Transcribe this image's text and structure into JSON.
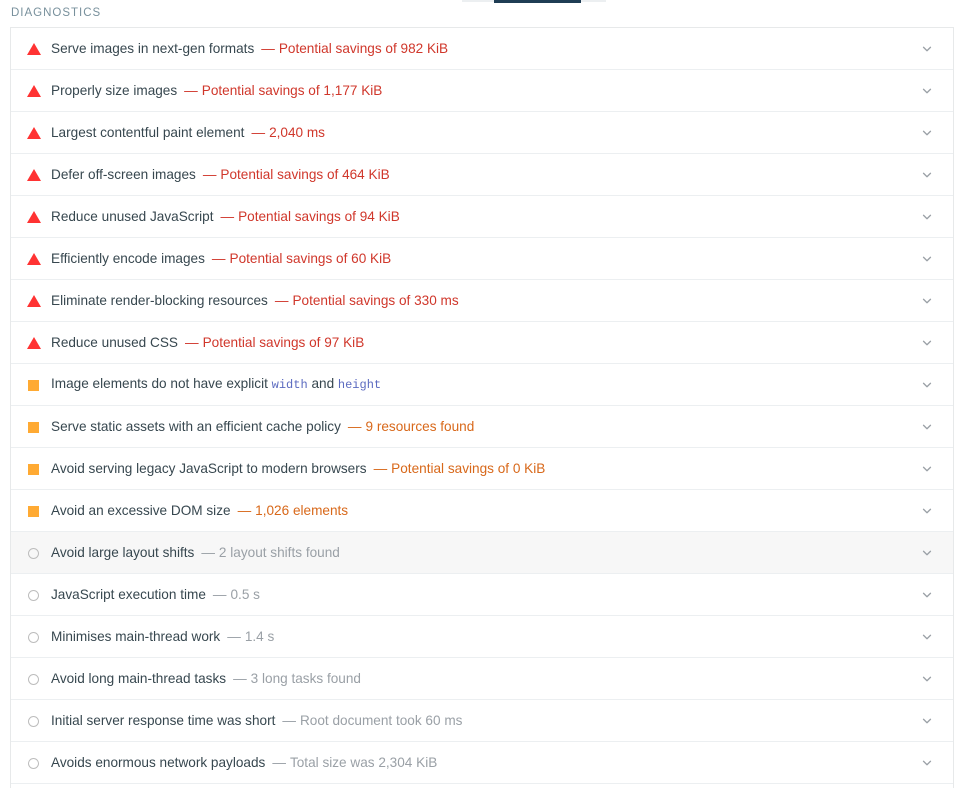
{
  "section": {
    "heading": "DIAGNOSTICS"
  },
  "colors": {
    "fail": "#d0372b",
    "average": "#d8681a",
    "pass": "#9aa0a6",
    "fail_icon": "#ff3333",
    "average_icon": "#ffaa33",
    "pass_icon": "#bdbdbd",
    "title_text": "#37474f",
    "heading_text": "#78909c",
    "tab_underline": "#1f3d54",
    "row_highlight": "#f7f7f7",
    "code_text": "#5c6bc0"
  },
  "icons": {
    "fail": "warning-triangle-icon",
    "average": "warning-square-icon",
    "pass": "circle-outline-icon",
    "expand": "chevron-down-icon"
  },
  "audits": [
    {
      "severity": "fail",
      "title": "Serve images in next-gen formats",
      "separator": "—",
      "display_value": "Potential savings of 982 KiB",
      "highlighted": false
    },
    {
      "severity": "fail",
      "title": "Properly size images",
      "separator": "—",
      "display_value": "Potential savings of 1,177 KiB",
      "highlighted": false
    },
    {
      "severity": "fail",
      "title": "Largest contentful paint element",
      "separator": "—",
      "display_value": "2,040 ms",
      "highlighted": false
    },
    {
      "severity": "fail",
      "title": "Defer off-screen images",
      "separator": "—",
      "display_value": "Potential savings of 464 KiB",
      "highlighted": false
    },
    {
      "severity": "fail",
      "title": "Reduce unused JavaScript",
      "separator": "—",
      "display_value": "Potential savings of 94 KiB",
      "highlighted": false
    },
    {
      "severity": "fail",
      "title": "Efficiently encode images",
      "separator": "—",
      "display_value": "Potential savings of 60 KiB",
      "highlighted": false
    },
    {
      "severity": "fail",
      "title": "Eliminate render-blocking resources",
      "separator": "—",
      "display_value": "Potential savings of 330 ms",
      "highlighted": false
    },
    {
      "severity": "fail",
      "title": "Reduce unused CSS",
      "separator": "—",
      "display_value": "Potential savings of 97 KiB",
      "highlighted": false
    },
    {
      "severity": "average",
      "title_parts": [
        {
          "type": "text",
          "value": "Image elements do not have explicit "
        },
        {
          "type": "code",
          "value": "width"
        },
        {
          "type": "text",
          "value": " and "
        },
        {
          "type": "code",
          "value": "height"
        }
      ],
      "title": "Image elements do not have explicit width and height",
      "separator": "",
      "display_value": "",
      "highlighted": false
    },
    {
      "severity": "average",
      "title": "Serve static assets with an efficient cache policy",
      "separator": "—",
      "display_value": "9 resources found",
      "highlighted": false
    },
    {
      "severity": "average",
      "title": "Avoid serving legacy JavaScript to modern browsers",
      "separator": "—",
      "display_value": "Potential savings of 0 KiB",
      "highlighted": false
    },
    {
      "severity": "average",
      "title": "Avoid an excessive DOM size",
      "separator": "—",
      "display_value": "1,026 elements",
      "highlighted": false
    },
    {
      "severity": "pass",
      "title": "Avoid large layout shifts",
      "separator": "—",
      "display_value": "2 layout shifts found",
      "highlighted": true
    },
    {
      "severity": "pass",
      "title": "JavaScript execution time",
      "separator": "—",
      "display_value": "0.5 s",
      "highlighted": false
    },
    {
      "severity": "pass",
      "title": "Minimises main-thread work",
      "separator": "—",
      "display_value": "1.4 s",
      "highlighted": false
    },
    {
      "severity": "pass",
      "title": "Avoid long main-thread tasks",
      "separator": "—",
      "display_value": "3 long tasks found",
      "highlighted": false
    },
    {
      "severity": "pass",
      "title": "Initial server response time was short",
      "separator": "—",
      "display_value": "Root document took 60 ms",
      "highlighted": false
    },
    {
      "severity": "pass",
      "title": "Avoids enormous network payloads",
      "separator": "—",
      "display_value": "Total size was 2,304 KiB",
      "highlighted": false
    }
  ]
}
